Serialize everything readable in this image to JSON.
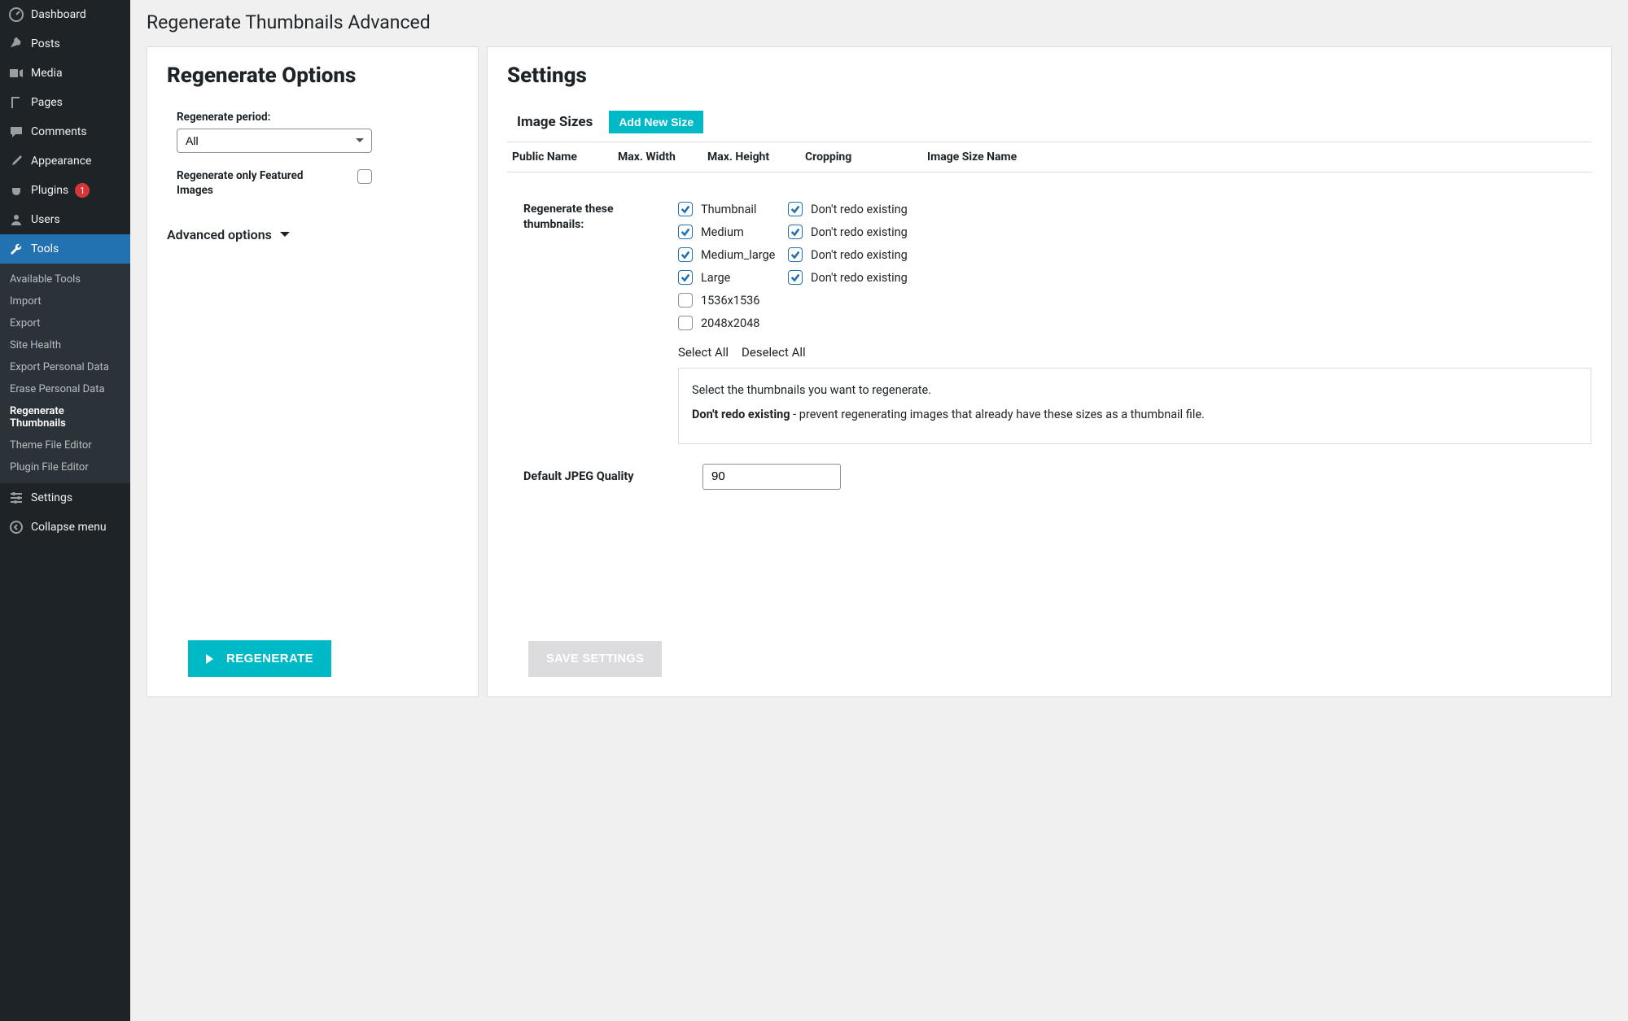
{
  "sidebar": {
    "items": [
      {
        "label": "Dashboard"
      },
      {
        "label": "Posts"
      },
      {
        "label": "Media"
      },
      {
        "label": "Pages"
      },
      {
        "label": "Comments"
      },
      {
        "label": "Appearance"
      },
      {
        "label": "Plugins",
        "badge": "1"
      },
      {
        "label": "Users"
      },
      {
        "label": "Tools"
      },
      {
        "label": "Settings"
      },
      {
        "label": "Collapse menu"
      }
    ],
    "tools_submenu": [
      "Available Tools",
      "Import",
      "Export",
      "Site Health",
      "Export Personal Data",
      "Erase Personal Data",
      "Regenerate Thumbnails",
      "Theme File Editor",
      "Plugin File Editor"
    ]
  },
  "page": {
    "title": "Regenerate Thumbnails Advanced"
  },
  "left": {
    "heading": "Regenerate Options",
    "period_label": "Regenerate period:",
    "period_value": "All",
    "featured_label": "Regenerate only Featured Images",
    "advanced_label": "Advanced options",
    "regenerate_button": "REGENERATE"
  },
  "right": {
    "heading": "Settings",
    "image_sizes": "Image Sizes",
    "add_new": "Add New Size",
    "columns": {
      "public_name": "Public Name",
      "max_width": "Max. Width",
      "max_height": "Max. Height",
      "cropping": "Cropping",
      "size_name": "Image Size Name"
    },
    "regen_label": "Regenerate these thumbnails:",
    "rows": [
      {
        "name": "Thumbnail",
        "redo": "Don't redo existing",
        "c1": true,
        "c2": true
      },
      {
        "name": "Medium",
        "redo": "Don't redo existing",
        "c1": true,
        "c2": true
      },
      {
        "name": "Medium_large",
        "redo": "Don't redo existing",
        "c1": true,
        "c2": true
      },
      {
        "name": "Large",
        "redo": "Don't redo existing",
        "c1": true,
        "c2": true
      },
      {
        "name": "1536x1536",
        "redo": "",
        "c1": false,
        "c2": null
      },
      {
        "name": "2048x2048",
        "redo": "",
        "c1": false,
        "c2": null
      }
    ],
    "select_all": "Select All",
    "deselect_all": "Deselect All",
    "help1": "Select the thumbnails you want to regenerate.",
    "help2_bold": "Don't redo existing",
    "help2_rest": " - prevent regenerating images that already have these sizes as a thumbnail file.",
    "jpeg_label": "Default JPEG Quality",
    "jpeg_value": "90",
    "save_button": "SAVE SETTINGS"
  }
}
